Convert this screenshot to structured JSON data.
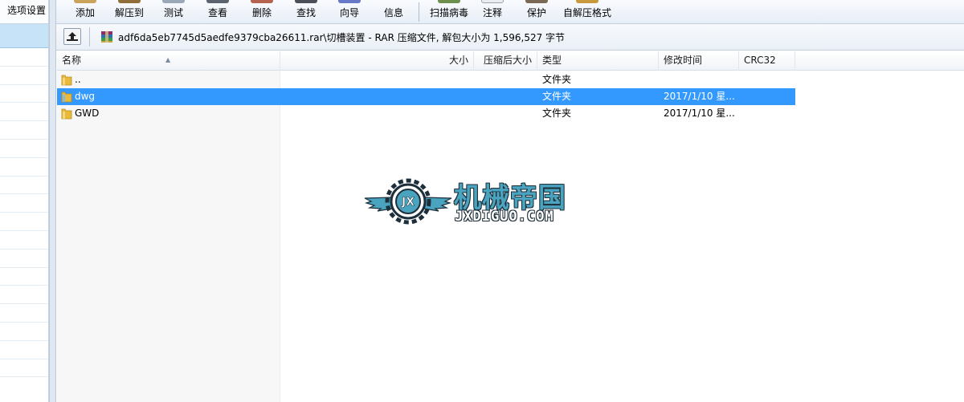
{
  "left_panel": {
    "options_label": "选项设置"
  },
  "toolbar": {
    "buttons": [
      {
        "label": "添加",
        "icon": "add-icon"
      },
      {
        "label": "解压到",
        "icon": "extract-icon"
      },
      {
        "label": "测试",
        "icon": "test-icon"
      },
      {
        "label": "查看",
        "icon": "view-icon"
      },
      {
        "label": "删除",
        "icon": "delete-icon"
      },
      {
        "label": "查找",
        "icon": "find-icon"
      },
      {
        "label": "向导",
        "icon": "wizard-icon"
      },
      {
        "label": "信息",
        "icon": "info-icon"
      },
      {
        "label": "扫描病毒",
        "icon": "virus-scan-icon"
      },
      {
        "label": "注释",
        "icon": "comment-icon"
      },
      {
        "label": "保护",
        "icon": "protect-icon"
      },
      {
        "label": "自解压格式",
        "icon": "sfx-icon"
      }
    ]
  },
  "path_bar": {
    "path": "adf6da5eb7745d5aedfe9379cba26611.rar\\切槽装置 - RAR 压缩文件, 解包大小为 1,596,527 字节"
  },
  "columns": {
    "name": "名称",
    "size": "大小",
    "packed": "压缩后大小",
    "type": "类型",
    "modified": "修改时间",
    "crc": "CRC32"
  },
  "files": [
    {
      "name": "..",
      "size": "",
      "packed": "",
      "type": "文件夹",
      "modified": "",
      "crc": "",
      "selected": false
    },
    {
      "name": "dwg",
      "size": "",
      "packed": "",
      "type": "文件夹",
      "modified": "2017/1/10 星...",
      "crc": "",
      "selected": true
    },
    {
      "name": "GWD",
      "size": "",
      "packed": "",
      "type": "文件夹",
      "modified": "2017/1/10 星...",
      "crc": "",
      "selected": false
    }
  ],
  "watermark": {
    "chinese": "机械帝国",
    "english": "JXDIGUO.COM"
  },
  "colors": {
    "selection": "#3399ff",
    "logo_blue": "#4aa3bf",
    "folder_yellow": "#e8b93a"
  }
}
